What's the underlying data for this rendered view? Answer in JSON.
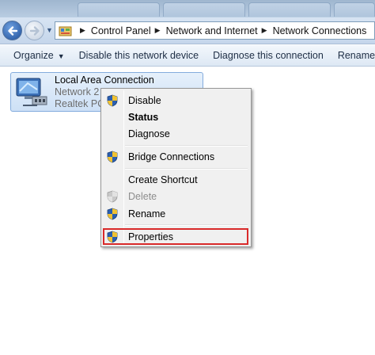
{
  "breadcrumb": [
    "Control Panel",
    "Network and Internet",
    "Network Connections"
  ],
  "commands": {
    "organize": "Organize",
    "disable_device": "Disable this network device",
    "diagnose": "Diagnose this connection",
    "rename": "Rename"
  },
  "connection": {
    "name": "Local Area Connection",
    "network": "Network  2",
    "adapter": "Realtek PCI"
  },
  "context_menu": {
    "disable": "Disable",
    "status": "Status",
    "diagnose": "Diagnose",
    "bridge": "Bridge Connections",
    "shortcut": "Create Shortcut",
    "delete": "Delete",
    "rename": "Rename",
    "properties": "Properties"
  },
  "icons": [
    "back-arrow-icon",
    "forward-arrow-icon",
    "control-panel-icon",
    "network-adapter-icon",
    "uac-shield-icon"
  ],
  "colors": {
    "highlight_box": "#d92a2a",
    "menu_bg": "#f0f0f0",
    "selection_bg": "#cde0f6"
  }
}
